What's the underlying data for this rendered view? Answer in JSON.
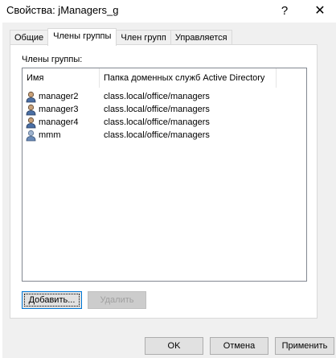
{
  "window": {
    "title": "Свойства: jManagers_g",
    "help_glyph": "?",
    "close_glyph": "✕"
  },
  "tabs": [
    {
      "label": "Общие",
      "active": false
    },
    {
      "label": "Члены группы",
      "active": true
    },
    {
      "label": "Член групп",
      "active": false
    },
    {
      "label": "Управляется",
      "active": false
    }
  ],
  "members": {
    "label": "Члены группы:",
    "columns": {
      "name": "Имя",
      "folder": "Папка доменных служб Active Directory"
    },
    "rows": [
      {
        "name": "manager2",
        "folder": "class.local/office/managers",
        "icon": "user-icon"
      },
      {
        "name": "manager3",
        "folder": "class.local/office/managers",
        "icon": "user-icon"
      },
      {
        "name": "manager4",
        "folder": "class.local/office/managers",
        "icon": "user-icon"
      },
      {
        "name": "mmm",
        "folder": "class.local/office/managers",
        "icon": "user-icon"
      }
    ],
    "add_label": "Добавить...",
    "remove_label": "Удалить"
  },
  "footer": {
    "ok_label": "OK",
    "cancel_label": "Отмена",
    "apply_label": "Применить"
  },
  "colors": {
    "dialog_bg": "#f0f0f0",
    "focus_border": "#0078d7"
  }
}
